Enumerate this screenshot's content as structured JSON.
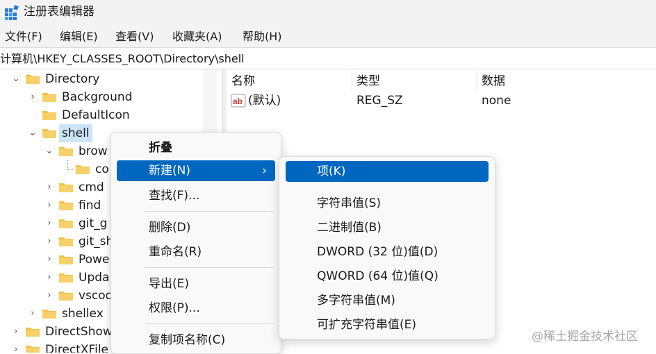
{
  "window": {
    "title": "注册表编辑器",
    "app_icon": "registry-editor-icon"
  },
  "menubar": {
    "items": [
      "文件(F)",
      "编辑(E)",
      "查看(V)",
      "收藏夹(A)",
      "帮助(H)"
    ]
  },
  "address": {
    "path": "计算机\\HKEY_CLASSES_ROOT\\Directory\\shell"
  },
  "tree": {
    "nodes": [
      {
        "label": "Directory",
        "expander": "expanded"
      },
      {
        "label": "Background",
        "expander": "collapsed"
      },
      {
        "label": "DefaultIcon",
        "expander": "none"
      },
      {
        "label": "shell",
        "expander": "expanded",
        "selected": true
      },
      {
        "label": "brow",
        "expander": "expanded"
      },
      {
        "label": "co",
        "expander": "none"
      },
      {
        "label": "cmd",
        "expander": "collapsed"
      },
      {
        "label": "find",
        "expander": "collapsed"
      },
      {
        "label": "git_g",
        "expander": "collapsed"
      },
      {
        "label": "git_sh",
        "expander": "collapsed"
      },
      {
        "label": "Powe",
        "expander": "collapsed"
      },
      {
        "label": "Upda",
        "expander": "collapsed"
      },
      {
        "label": "vscod",
        "expander": "collapsed"
      },
      {
        "label": "shellex",
        "expander": "collapsed"
      },
      {
        "label": "DirectShow",
        "expander": "collapsed"
      },
      {
        "label": "DirectXFile",
        "expander": "collapsed"
      }
    ]
  },
  "values": {
    "columns": [
      "名称",
      "类型",
      "数据"
    ],
    "rows": [
      {
        "name": "(默认)",
        "type": "REG_SZ",
        "data": "none",
        "icon": "string-value-icon"
      }
    ]
  },
  "context_menu": {
    "collapse": "折叠",
    "new": "新建(N)",
    "find": "查找(F)...",
    "delete": "删除(D)",
    "rename": "重命名(R)",
    "export": "导出(E)",
    "permissions": "权限(P)...",
    "copy_key_name": "复制项名称(C)"
  },
  "submenu": {
    "key": "项(K)",
    "string_value": "字符串值(S)",
    "binary_value": "二进制值(B)",
    "dword_value": "DWORD (32 位)值(D)",
    "qword_value": "QWORD (64 位)值(Q)",
    "multi_string_value": "多字符串值(M)",
    "expandable_string_value": "可扩充字符串值(E)"
  },
  "colors": {
    "highlight": "#0067c0",
    "selection": "#cce4f7",
    "folder": "#f3c245"
  },
  "watermark": "@稀土掘金技术社区"
}
